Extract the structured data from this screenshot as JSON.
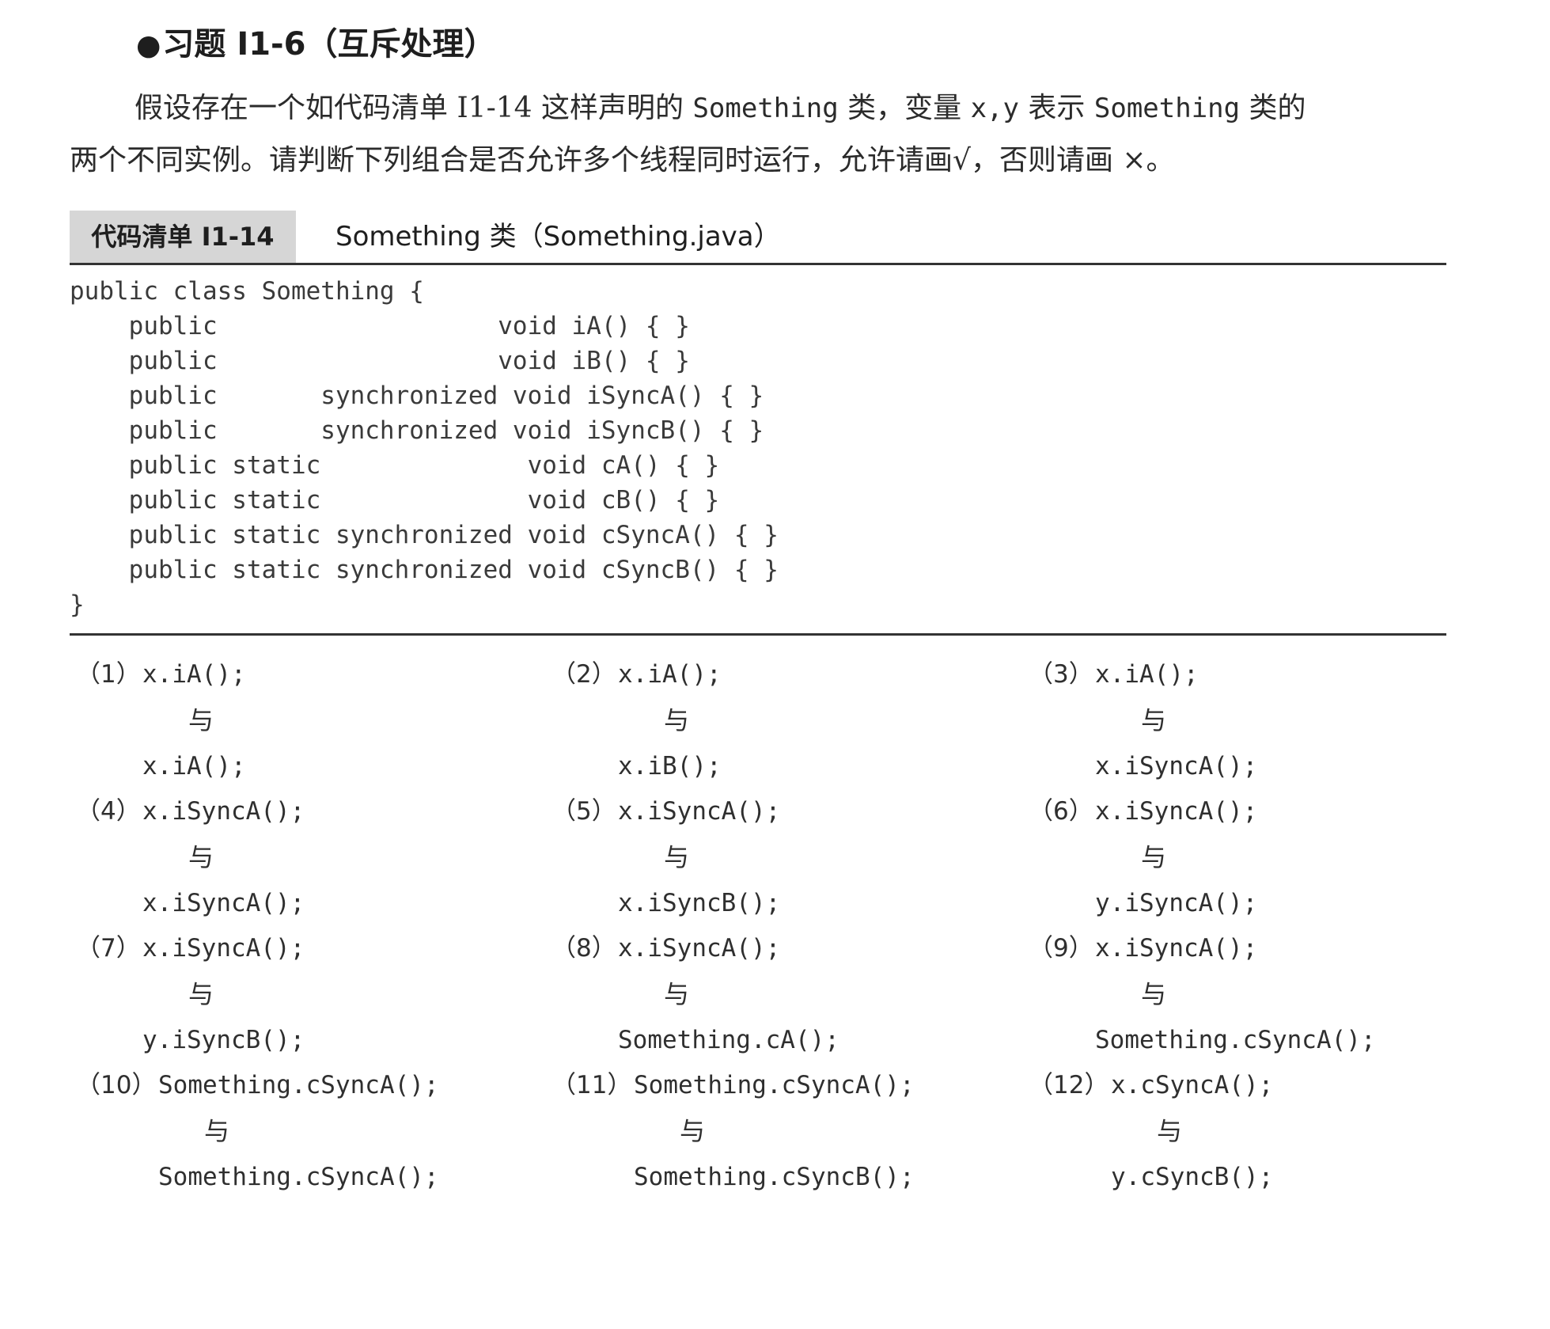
{
  "heading": {
    "bullet": "●",
    "text": "习题 I1-6（互斥处理）"
  },
  "intro": {
    "line1_before": "假设存在一个如代码清单 I1-14 这样声明的 ",
    "line1_class": "Something",
    "line1_mid": " 类，变量 ",
    "line1_vars": "x,y",
    "line1_mid2": " 表示 ",
    "line1_class2": "Something",
    "line1_after": " 类的",
    "line2": "两个不同实例。请判断下列组合是否允许多个线程同时运行，允许请画√，否则请画 ×。"
  },
  "listing": {
    "tag": "代码清单 I1-14",
    "title": "Something 类（Something.java）"
  },
  "code": [
    "public class Something {",
    "    public                   void iA() { }",
    "    public                   void iB() { }",
    "    public       synchronized void iSyncA() { }",
    "    public       synchronized void iSyncB() { }",
    "    public static              void cA() { }",
    "    public static              void cB() { }",
    "    public static synchronized void cSyncA() { }",
    "    public static synchronized void cSyncB() { }",
    "}"
  ],
  "conj": "与",
  "items": [
    {
      "num": "（1）",
      "first": "x.iA();",
      "second": "x.iA();"
    },
    {
      "num": "（2）",
      "first": "x.iA();",
      "second": "x.iB();"
    },
    {
      "num": "（3）",
      "first": "x.iA();",
      "second": "x.iSyncA();"
    },
    {
      "num": "（4）",
      "first": "x.iSyncA();",
      "second": "x.iSyncA();"
    },
    {
      "num": "（5）",
      "first": "x.iSyncA();",
      "second": "x.iSyncB();"
    },
    {
      "num": "（6）",
      "first": "x.iSyncA();",
      "second": "y.iSyncA();"
    },
    {
      "num": "（7）",
      "first": "x.iSyncA();",
      "second": "y.iSyncB();"
    },
    {
      "num": "（8）",
      "first": "x.iSyncA();",
      "second": "Something.cA();"
    },
    {
      "num": "（9）",
      "first": "x.iSyncA();",
      "second": "Something.cSyncA();"
    },
    {
      "num": "（10）",
      "first": "Something.cSyncA();",
      "second": "Something.cSyncA();"
    },
    {
      "num": "（11）",
      "first": "Something.cSyncA();",
      "second": "Something.cSyncB();"
    },
    {
      "num": "（12）",
      "first": "x.cSyncA();",
      "second": "y.cSyncB();"
    }
  ]
}
